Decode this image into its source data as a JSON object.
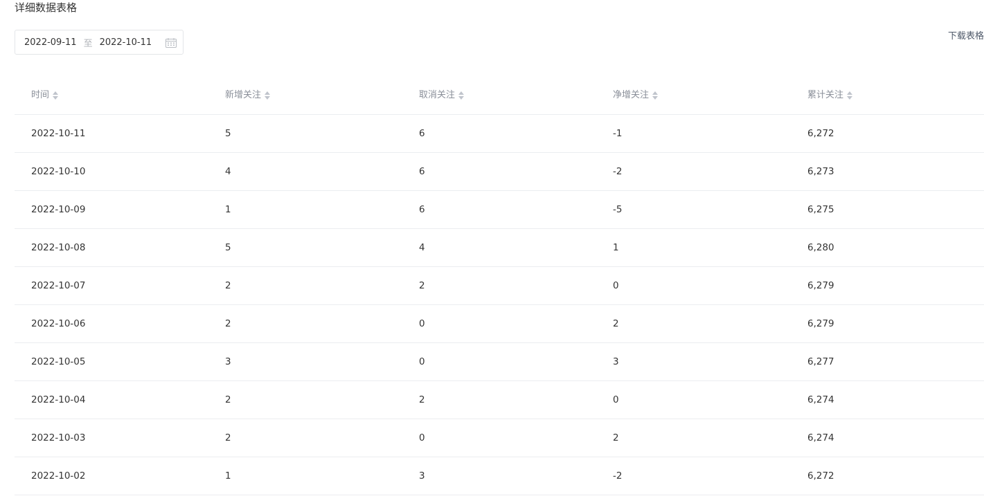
{
  "section_title": "详细数据表格",
  "date_range": {
    "start": "2022-09-11",
    "separator": "至",
    "end": "2022-10-11"
  },
  "download_label": "下载表格",
  "icons": {
    "calendar": "calendar-icon",
    "sort": "sort-icon"
  },
  "colors": {
    "header_text": "#8a8f99",
    "row_divider": "#ebedf0",
    "link": "#4e5969"
  },
  "table": {
    "columns": [
      "时间",
      "新增关注",
      "取消关注",
      "净增关注",
      "累计关注"
    ],
    "rows": [
      [
        "2022-10-11",
        "5",
        "6",
        "-1",
        "6,272"
      ],
      [
        "2022-10-10",
        "4",
        "6",
        "-2",
        "6,273"
      ],
      [
        "2022-10-09",
        "1",
        "6",
        "-5",
        "6,275"
      ],
      [
        "2022-10-08",
        "5",
        "4",
        "1",
        "6,280"
      ],
      [
        "2022-10-07",
        "2",
        "2",
        "0",
        "6,279"
      ],
      [
        "2022-10-06",
        "2",
        "0",
        "2",
        "6,279"
      ],
      [
        "2022-10-05",
        "3",
        "0",
        "3",
        "6,277"
      ],
      [
        "2022-10-04",
        "2",
        "2",
        "0",
        "6,274"
      ],
      [
        "2022-10-03",
        "2",
        "0",
        "2",
        "6,274"
      ],
      [
        "2022-10-02",
        "1",
        "3",
        "-2",
        "6,272"
      ]
    ]
  }
}
